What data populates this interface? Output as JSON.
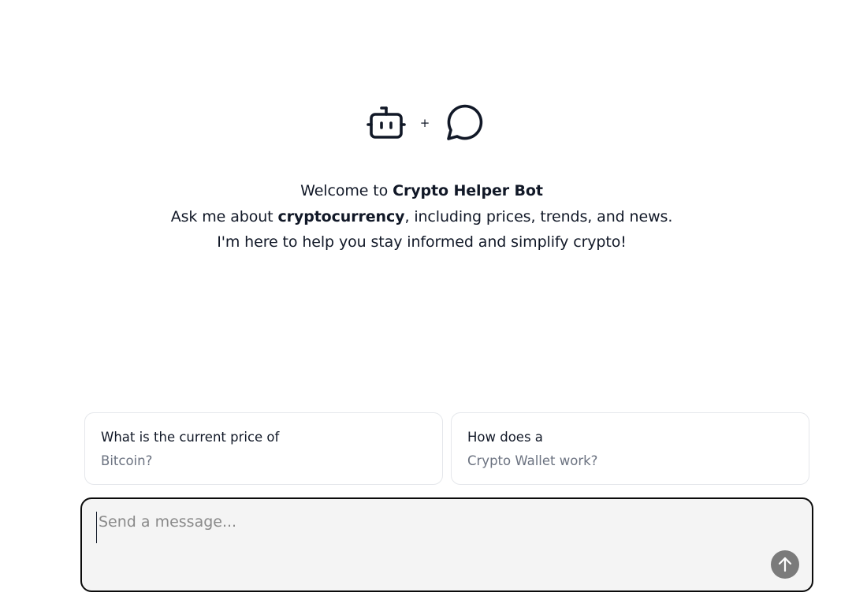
{
  "hero": {
    "icons": [
      "bot-icon",
      "chat-bubble-icon"
    ],
    "plus": "+"
  },
  "welcome": {
    "line1_prefix": "Welcome to ",
    "bot_name": "Crypto Helper Bot",
    "line2_prefix": "Ask me about ",
    "topic": "cryptocurrency",
    "line2_suffix": ", including prices, trends, and news.",
    "line3": "I'm here to help you stay informed and simplify crypto!"
  },
  "suggestions": [
    {
      "title": "What is the current price of",
      "subtitle": "Bitcoin?"
    },
    {
      "title": "How does a",
      "subtitle": "Crypto Wallet work?"
    }
  ],
  "composer": {
    "placeholder": "Send a message...",
    "value": "",
    "send_icon": "arrow-up-icon"
  },
  "colors": {
    "text": "#111827",
    "muted": "#6b7280",
    "composer_bg": "#f4f4f4",
    "send_button": "#7b7b7b"
  }
}
